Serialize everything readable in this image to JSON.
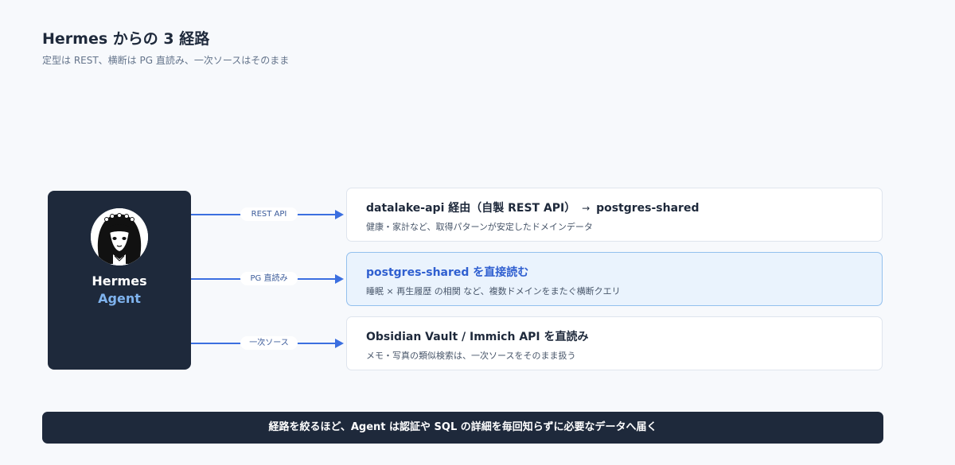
{
  "header": {
    "title": "Hermes からの 3 経路",
    "subtitle": "定型は REST、横断は PG 直読み、一次ソースはそのまま"
  },
  "agent": {
    "name": "Hermes",
    "role": "Agent"
  },
  "connectors": [
    {
      "label": "REST API"
    },
    {
      "label": "PG 直読み"
    },
    {
      "label": "一次ソース"
    }
  ],
  "routes": [
    {
      "title_main": "datalake-api 経由（自製 REST API）",
      "title_arrow": "→",
      "title_end": "postgres-shared",
      "description": "健康・家計など、取得パターンが安定したドメインデータ"
    },
    {
      "title": "postgres-shared を直接読む",
      "description": "睡眠 × 再生履歴 の相関 など、複数ドメインをまたぐ横断クエリ"
    },
    {
      "title": "Obsidian Vault / Immich API を直読み",
      "description": "メモ・写真の類似検索は、一次ソースをそのまま扱う"
    }
  ],
  "footer": {
    "text": "経路を絞るほど、Agent は認証や SQL の詳細を毎回知らずに必要なデータへ届く"
  },
  "colors": {
    "dark": "#1e293b",
    "accent": "#3b6fe0",
    "highlight_bg": "#eaf3fd"
  }
}
